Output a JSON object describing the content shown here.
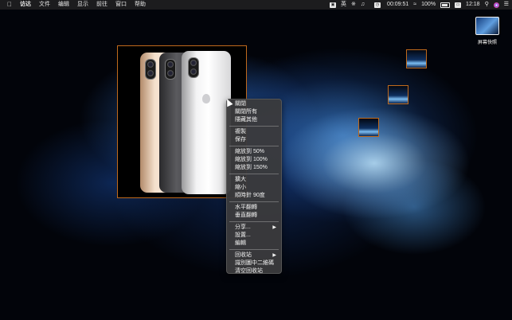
{
  "menubar": {
    "apple_icon": "apple-icon",
    "items": [
      "访达",
      "文件",
      "编辑",
      "显示",
      "前往",
      "窗口",
      "帮助"
    ],
    "status": {
      "input_method": "英",
      "timer": "00:09:51",
      "battery": "100%",
      "time": "12:18",
      "icons": [
        "app-status-icon",
        "bluetooth-icon",
        "volume-icon",
        "timer-icon",
        "wifi-icon",
        "battery-icon",
        "screen-mirror-icon",
        "search-icon",
        "siri-icon",
        "notification-center-icon"
      ]
    }
  },
  "desktop": {
    "icons": [
      {
        "label": "屏幕快照"
      }
    ]
  },
  "context_menu": {
    "groups": [
      [
        "關閉",
        "關閉所有",
        "隱藏其他"
      ],
      [
        "複製",
        "保存"
      ],
      [
        "縮放到 50%",
        "縮放到 100%",
        "縮放到 150%"
      ],
      [
        "擴大",
        "縮小",
        "順時針 90度"
      ],
      [
        "水平翻轉",
        "垂直翻轉"
      ],
      [
        "分享...",
        "設置...",
        "編輯"
      ],
      [
        "回收站",
        "識別圖中二維碼",
        "清空回收站"
      ]
    ],
    "submenu_items": [
      "分享...",
      "回收站"
    ]
  },
  "colors": {
    "window_border": "#c06a1c",
    "menubar_bg": "#1c1c1e",
    "menu_bg": "#3a3a3c"
  }
}
